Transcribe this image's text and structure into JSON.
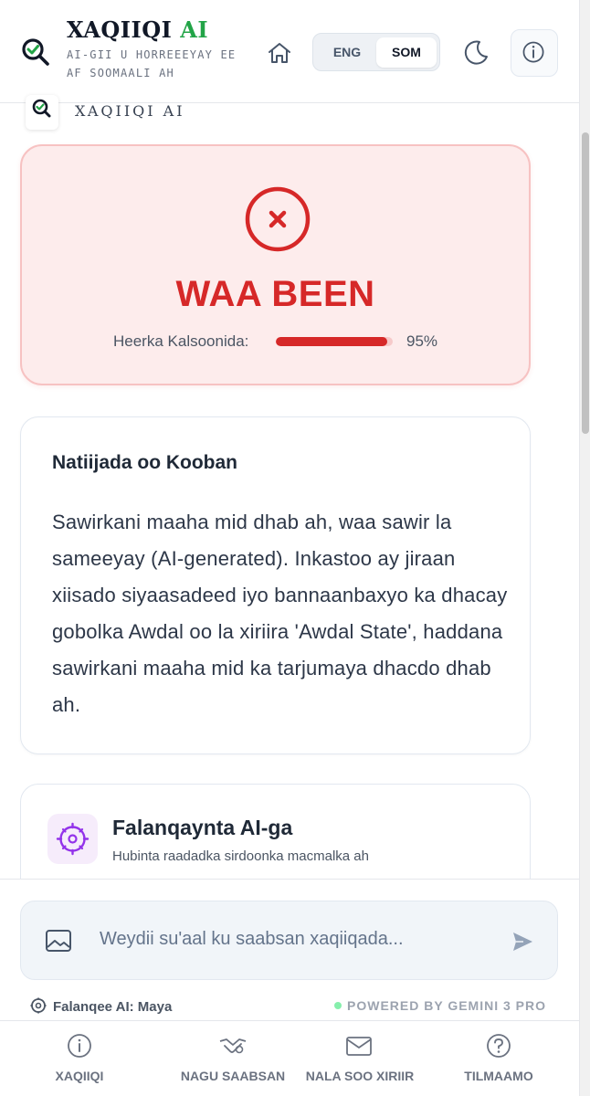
{
  "header": {
    "title_main": "XAQIIQI",
    "title_accent": "AI",
    "subtitle_line1": "AI-GII U HORREEEYAY EE",
    "subtitle_line2": "AF SOOMAALI AH",
    "languages": [
      "ENG",
      "SOM"
    ],
    "active_language": "SOM",
    "icons": [
      "search-check-icon",
      "home-icon",
      "moon-icon",
      "info-icon"
    ]
  },
  "mini_brand": "XAQIIQI AI",
  "verdict": {
    "label": "WAA BEEN",
    "confidence_label": "Heerka Kalsoonida:",
    "confidence_value": "95%",
    "confidence_fraction": 0.95,
    "accent_color": "#d62828",
    "icon": "x-circle-icon"
  },
  "summary": {
    "title": "Natiijada oo Kooban",
    "body": "Sawirkani maaha mid dhab ah, waa sawir la sameeyay (AI-generated). Inkastoo ay jiraan xiisado siyaasadeed iyo bannaanbaxyo ka dhacay gobolka Awdal oo la xiriira 'Awdal State', haddana sawirkani maaha mid ka tarjumaya dhacdo dhab ah."
  },
  "analysis": {
    "title": "Falanqaynta AI-ga",
    "subtitle": "Hubinta raadadka sirdoonka macmalka ah",
    "icon": "ai-chip-icon"
  },
  "chat": {
    "placeholder": "Weydii su'aal ku saabsan xaqiiqada...",
    "ai_status": "Falanqee AI: Maya",
    "powered_by": "POWERED BY GEMINI 3 PRO"
  },
  "nav": {
    "items": [
      {
        "label": "XAQIIQI",
        "icon": "info-icon"
      },
      {
        "label": "NAGU SAABSAN",
        "icon": "handshake-icon"
      },
      {
        "label": "NALA SOO XIRIIR",
        "icon": "mail-icon"
      },
      {
        "label": "TILMAAMO",
        "icon": "help-icon"
      }
    ]
  }
}
